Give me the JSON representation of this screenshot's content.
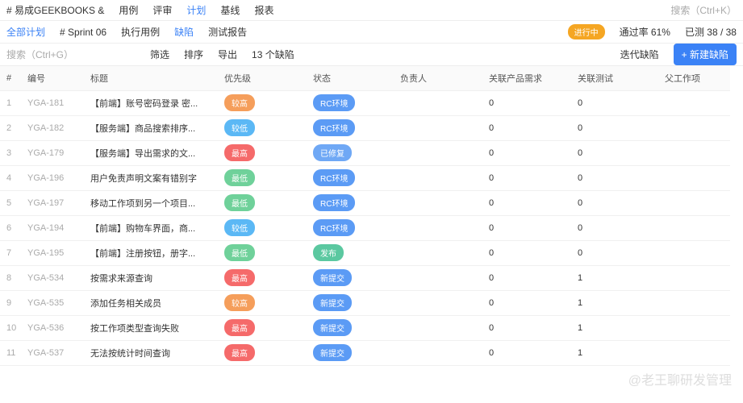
{
  "top": {
    "project": "# 易成GEEKBOOKS &",
    "tabs": [
      "用例",
      "评审",
      "计划",
      "基线",
      "报表"
    ],
    "search": "搜索（Ctrl+K）"
  },
  "sub": {
    "crumb": "全部计划",
    "sprint": "# Sprint 06",
    "tabs": [
      "执行用例",
      "缺陷",
      "测试报告"
    ],
    "status": "进行中",
    "pass": "通过率 61%",
    "done": "已测 38 / 38"
  },
  "tool": {
    "search": "搜索（Ctrl+G）",
    "filter": "筛选",
    "sort": "排序",
    "export": "导出",
    "count": "13 个缺陷",
    "iter": "迭代缺陷",
    "new": "+ 新建缺陷"
  },
  "headers": [
    "#",
    "编号",
    "标题",
    "优先级",
    "状态",
    "负责人",
    "关联产品需求",
    "关联测试",
    "父工作项"
  ],
  "rows": [
    [
      "1",
      "YGA-181",
      "【前端】账号密码登录 密...",
      "较高",
      "#f59e5b",
      "RC环境",
      "#5b9bf5",
      "0",
      "0"
    ],
    [
      "2",
      "YGA-182",
      "【服务端】商品搜索排序...",
      "较低",
      "#5bb8f5",
      "RC环境",
      "#5b9bf5",
      "0",
      "0"
    ],
    [
      "3",
      "YGA-179",
      "【服务端】导出需求的文...",
      "最高",
      "#f56a6a",
      "已修复",
      "#6fa8f5",
      "0",
      "0"
    ],
    [
      "4",
      "YGA-196",
      "用户免责声明文案有错别字",
      "最低",
      "#6fd19a",
      "RC环境",
      "#5b9bf5",
      "0",
      "0"
    ],
    [
      "5",
      "YGA-197",
      "移动工作项到另一个项目...",
      "最低",
      "#6fd19a",
      "RC环境",
      "#5b9bf5",
      "0",
      "0"
    ],
    [
      "6",
      "YGA-194",
      "【前端】购物车界面，商...",
      "较低",
      "#5bb8f5",
      "RC环境",
      "#5b9bf5",
      "0",
      "0"
    ],
    [
      "7",
      "YGA-195",
      "【前端】注册按钮，册字...",
      "最低",
      "#6fd19a",
      "发布",
      "#5bc8a0",
      "0",
      "0"
    ],
    [
      "8",
      "YGA-534",
      "按需求来源查询",
      "最高",
      "#f56a6a",
      "新提交",
      "#5b9bf5",
      "0",
      "1"
    ],
    [
      "9",
      "YGA-535",
      "添加任务相关成员",
      "较高",
      "#f59e5b",
      "新提交",
      "#5b9bf5",
      "0",
      "1"
    ],
    [
      "10",
      "YGA-536",
      "按工作项类型查询失败",
      "最高",
      "#f56a6a",
      "新提交",
      "#5b9bf5",
      "0",
      "1"
    ],
    [
      "11",
      "YGA-537",
      "无法按统计时间查询",
      "最高",
      "#f56a6a",
      "新提交",
      "#5b9bf5",
      "0",
      "1"
    ]
  ],
  "watermark": "@老王聊研发管理"
}
